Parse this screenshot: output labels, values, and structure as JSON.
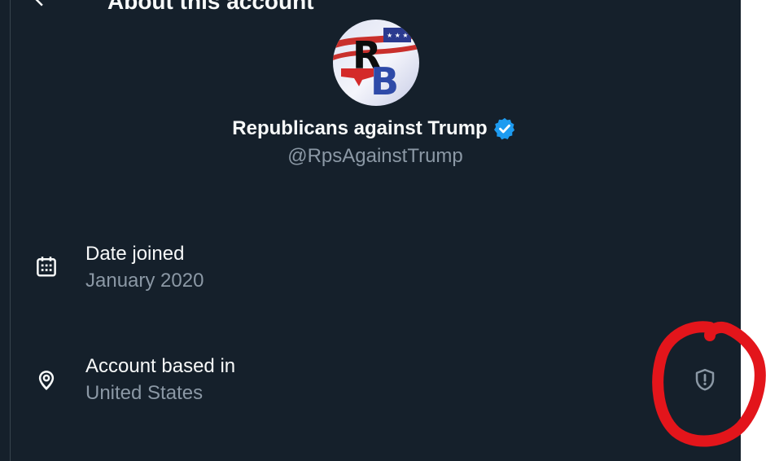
{
  "header": {
    "title": "About this account",
    "back_icon": "arrow-left-icon"
  },
  "profile": {
    "avatar_letters": "RB",
    "display_name": "Republicans against Trump",
    "verified_icon": "verified-badge-icon",
    "handle": "@RpsAgainstTrump"
  },
  "details": [
    {
      "icon": "calendar-icon",
      "label": "Date joined",
      "value": "January 2020"
    },
    {
      "icon": "location-pin-icon",
      "label": "Account based in",
      "value": "United States"
    }
  ],
  "location_info_icon": "shield-alert-icon",
  "annotation": {
    "color": "#e3151b"
  },
  "colors": {
    "background": "#15202b",
    "primary_text": "#f7f9f9",
    "secondary_text": "#8b98a5",
    "verified": "#1d9bf0"
  }
}
